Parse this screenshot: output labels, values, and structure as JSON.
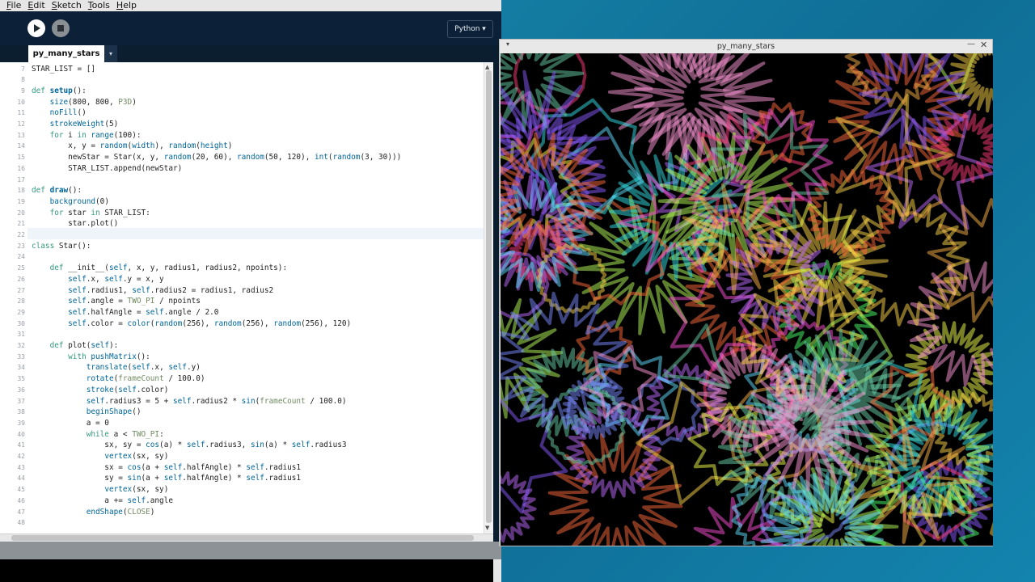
{
  "ide": {
    "menu": [
      "File",
      "Edit",
      "Sketch",
      "Tools",
      "Help"
    ],
    "mode_label": "Python ▾",
    "tab_label": "py_many_stars",
    "tab_menu_label": "▾"
  },
  "editor": {
    "line_numbers": [
      "7",
      "8",
      "9",
      "10",
      "11",
      "12",
      "13",
      "14",
      "15",
      "16",
      "17",
      "18",
      "19",
      "20",
      "21",
      "22",
      "23",
      "24",
      "25",
      "26",
      "27",
      "28",
      "29",
      "30",
      "31",
      "32",
      "33",
      "34",
      "35",
      "36",
      "37",
      "38",
      "39",
      "40",
      "41",
      "42",
      "43",
      "44",
      "45",
      "46",
      "47",
      "48"
    ],
    "lines": [
      [
        [
          "STAR_LIST = []",
          ""
        ]
      ],
      [
        [
          "",
          ""
        ]
      ],
      [
        [
          "def ",
          "kw"
        ],
        [
          "setup",
          "fb"
        ],
        [
          "():",
          ""
        ]
      ],
      [
        [
          "    ",
          ""
        ],
        [
          "size",
          "fn"
        ],
        [
          "(800, 800, ",
          ""
        ],
        [
          "P3D",
          "co"
        ],
        [
          ")",
          ""
        ]
      ],
      [
        [
          "    ",
          ""
        ],
        [
          "noFill",
          "fn"
        ],
        [
          "()",
          ""
        ]
      ],
      [
        [
          "    ",
          ""
        ],
        [
          "strokeWeight",
          "fn"
        ],
        [
          "(5)",
          ""
        ]
      ],
      [
        [
          "    ",
          ""
        ],
        [
          "for ",
          "kw"
        ],
        [
          "i ",
          ""
        ],
        [
          "in ",
          "kw"
        ],
        [
          "range",
          "fn"
        ],
        [
          "(100):",
          ""
        ]
      ],
      [
        [
          "        x, y = ",
          ""
        ],
        [
          "random",
          "fn"
        ],
        [
          "(",
          ""
        ],
        [
          "width",
          "fn"
        ],
        [
          "), ",
          ""
        ],
        [
          "random",
          "fn"
        ],
        [
          "(",
          ""
        ],
        [
          "height",
          "fn"
        ],
        [
          ")",
          ""
        ]
      ],
      [
        [
          "        newStar = Star(x, y, ",
          ""
        ],
        [
          "random",
          "fn"
        ],
        [
          "(20, 60), ",
          ""
        ],
        [
          "random",
          "fn"
        ],
        [
          "(50, 120), ",
          ""
        ],
        [
          "int",
          "fn"
        ],
        [
          "(",
          ""
        ],
        [
          "random",
          "fn"
        ],
        [
          "(3, 30)))",
          ""
        ]
      ],
      [
        [
          "        STAR_LIST.append(newStar)",
          ""
        ]
      ],
      [
        [
          "",
          ""
        ]
      ],
      [
        [
          "def ",
          "kw"
        ],
        [
          "draw",
          "fb"
        ],
        [
          "():",
          ""
        ]
      ],
      [
        [
          "    ",
          ""
        ],
        [
          "background",
          "fn"
        ],
        [
          "(0)",
          ""
        ]
      ],
      [
        [
          "    ",
          ""
        ],
        [
          "for ",
          "kw"
        ],
        [
          "star ",
          ""
        ],
        [
          "in ",
          "kw"
        ],
        [
          "STAR_LIST:",
          ""
        ]
      ],
      [
        [
          "        star.plot()",
          ""
        ]
      ],
      [
        [
          "",
          ""
        ]
      ],
      [
        [
          "class ",
          "kw"
        ],
        [
          "Star():",
          ""
        ]
      ],
      [
        [
          "",
          ""
        ]
      ],
      [
        [
          "    ",
          ""
        ],
        [
          "def ",
          "kw"
        ],
        [
          "__init__(",
          ""
        ],
        [
          "self",
          "fn"
        ],
        [
          ", x, y, radius1, radius2, npoints):",
          ""
        ]
      ],
      [
        [
          "        ",
          ""
        ],
        [
          "self",
          "fn"
        ],
        [
          ".x, ",
          ""
        ],
        [
          "self",
          "fn"
        ],
        [
          ".y = x, y",
          ""
        ]
      ],
      [
        [
          "        ",
          ""
        ],
        [
          "self",
          "fn"
        ],
        [
          ".radius1, ",
          ""
        ],
        [
          "self",
          "fn"
        ],
        [
          ".radius2 = radius1, radius2",
          ""
        ]
      ],
      [
        [
          "        ",
          ""
        ],
        [
          "self",
          "fn"
        ],
        [
          ".angle = ",
          ""
        ],
        [
          "TWO_PI",
          "co"
        ],
        [
          " / npoints",
          ""
        ]
      ],
      [
        [
          "        ",
          ""
        ],
        [
          "self",
          "fn"
        ],
        [
          ".halfAngle = ",
          ""
        ],
        [
          "self",
          "fn"
        ],
        [
          ".angle / 2.0",
          ""
        ]
      ],
      [
        [
          "        ",
          ""
        ],
        [
          "self",
          "fn"
        ],
        [
          ".color = ",
          ""
        ],
        [
          "color",
          "fn"
        ],
        [
          "(",
          ""
        ],
        [
          "random",
          "fn"
        ],
        [
          "(256), ",
          ""
        ],
        [
          "random",
          "fn"
        ],
        [
          "(256), ",
          ""
        ],
        [
          "random",
          "fn"
        ],
        [
          "(256), 120)",
          ""
        ]
      ],
      [
        [
          "",
          ""
        ]
      ],
      [
        [
          "    ",
          ""
        ],
        [
          "def ",
          "kw"
        ],
        [
          "plot(",
          ""
        ],
        [
          "self",
          "fn"
        ],
        [
          "):",
          ""
        ]
      ],
      [
        [
          "        ",
          ""
        ],
        [
          "with ",
          "kw"
        ],
        [
          "pushMatrix",
          "fn"
        ],
        [
          "():",
          ""
        ]
      ],
      [
        [
          "            ",
          ""
        ],
        [
          "translate",
          "fn"
        ],
        [
          "(",
          ""
        ],
        [
          "self",
          "fn"
        ],
        [
          ".x, ",
          ""
        ],
        [
          "self",
          "fn"
        ],
        [
          ".y)",
          ""
        ]
      ],
      [
        [
          "            ",
          ""
        ],
        [
          "rotate",
          "fn"
        ],
        [
          "(",
          ""
        ],
        [
          "frameCount",
          "co"
        ],
        [
          " / 100.0)",
          ""
        ]
      ],
      [
        [
          "            ",
          ""
        ],
        [
          "stroke",
          "fn"
        ],
        [
          "(",
          ""
        ],
        [
          "self",
          "fn"
        ],
        [
          ".color)",
          ""
        ]
      ],
      [
        [
          "            ",
          ""
        ],
        [
          "self",
          "fn"
        ],
        [
          ".radius3 = 5 + ",
          ""
        ],
        [
          "self",
          "fn"
        ],
        [
          ".radius2 * ",
          ""
        ],
        [
          "sin",
          "fn"
        ],
        [
          "(",
          ""
        ],
        [
          "frameCount",
          "co"
        ],
        [
          " / 100.0)",
          ""
        ]
      ],
      [
        [
          "            ",
          ""
        ],
        [
          "beginShape",
          "fn"
        ],
        [
          "()",
          ""
        ]
      ],
      [
        [
          "            a = 0",
          ""
        ]
      ],
      [
        [
          "            ",
          ""
        ],
        [
          "while ",
          "kw"
        ],
        [
          "a < ",
          ""
        ],
        [
          "TWO_PI",
          "co"
        ],
        [
          ":",
          ""
        ]
      ],
      [
        [
          "                sx, sy = ",
          ""
        ],
        [
          "cos",
          "fn"
        ],
        [
          "(a) * ",
          ""
        ],
        [
          "self",
          "fn"
        ],
        [
          ".radius3, ",
          ""
        ],
        [
          "sin",
          "fn"
        ],
        [
          "(a) * ",
          ""
        ],
        [
          "self",
          "fn"
        ],
        [
          ".radius3",
          ""
        ]
      ],
      [
        [
          "                ",
          ""
        ],
        [
          "vertex",
          "fn"
        ],
        [
          "(sx, sy)",
          ""
        ]
      ],
      [
        [
          "                sx = ",
          ""
        ],
        [
          "cos",
          "fn"
        ],
        [
          "(a + ",
          ""
        ],
        [
          "self",
          "fn"
        ],
        [
          ".halfAngle) * ",
          ""
        ],
        [
          "self",
          "fn"
        ],
        [
          ".radius1",
          ""
        ]
      ],
      [
        [
          "                sy = ",
          ""
        ],
        [
          "sin",
          "fn"
        ],
        [
          "(a + ",
          ""
        ],
        [
          "self",
          "fn"
        ],
        [
          ".halfAngle) * ",
          ""
        ],
        [
          "self",
          "fn"
        ],
        [
          ".radius1",
          ""
        ]
      ],
      [
        [
          "                ",
          ""
        ],
        [
          "vertex",
          "fn"
        ],
        [
          "(sx, sy)",
          ""
        ]
      ],
      [
        [
          "                a += ",
          ""
        ],
        [
          "self",
          "fn"
        ],
        [
          ".angle",
          ""
        ]
      ],
      [
        [
          "            ",
          ""
        ],
        [
          "endShape",
          "fn"
        ],
        [
          "(",
          ""
        ],
        [
          "CLOSE",
          "co"
        ],
        [
          ")",
          ""
        ]
      ],
      [
        [
          "",
          ""
        ]
      ]
    ]
  },
  "sketch": {
    "title": "py_many_stars",
    "background": "#000000",
    "star_colors": [
      "#ff4fd8",
      "#33e0e6",
      "#f4ff4a",
      "#ff3b7a",
      "#8a5cff",
      "#4cff6a",
      "#ffb34a",
      "#c06cff",
      "#5fe0ff",
      "#ff6b3b",
      "#b8ff5a",
      "#ff9ad8",
      "#6ad0a8",
      "#ffd84a",
      "#7a8cff"
    ]
  },
  "colors": {
    "ide_bg": "#0b1e30",
    "toolbar_bg": "#0c2137",
    "desktop": "#137aa0"
  }
}
